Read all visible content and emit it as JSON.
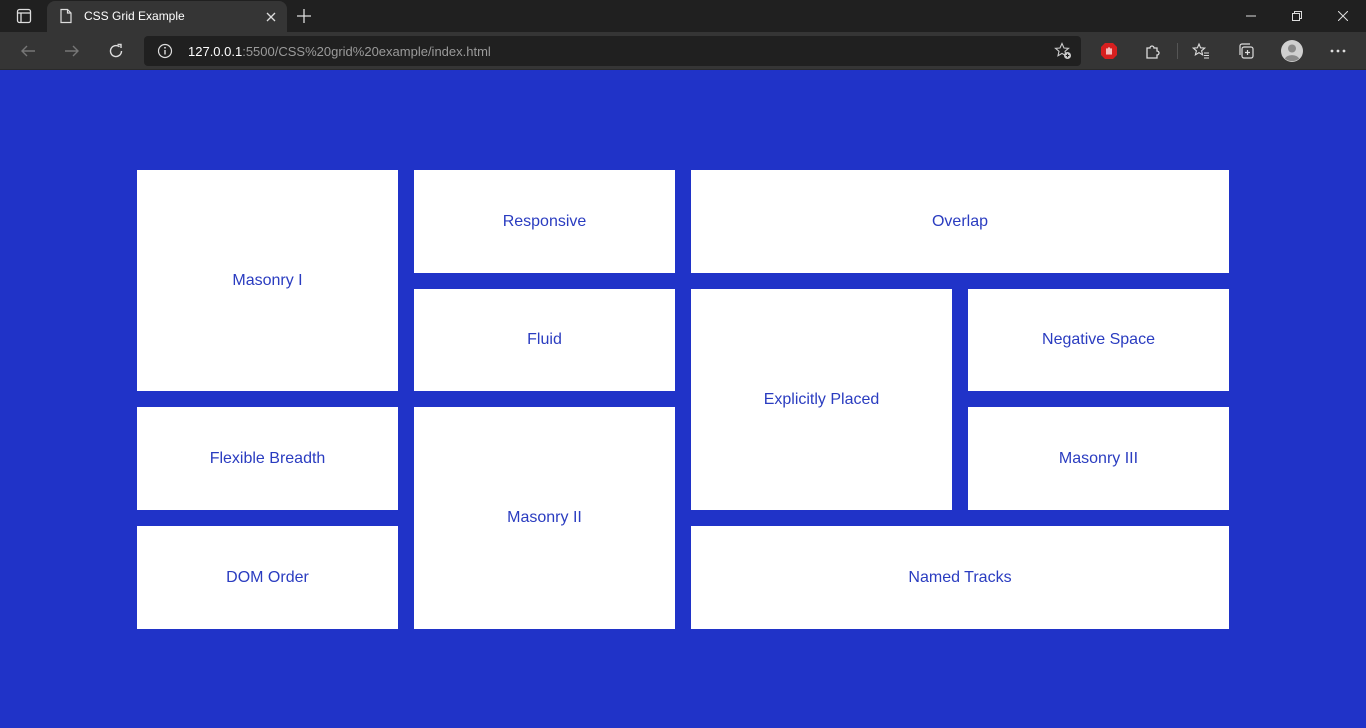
{
  "browser": {
    "tab_title": "CSS Grid Example",
    "url_host": "127.0.0.1",
    "url_rest": ":5500/CSS%20grid%20example/index.html"
  },
  "colors": {
    "page_background": "#2033c8",
    "cell_background": "#ffffff",
    "cell_text": "#2a3cc0"
  },
  "grid": {
    "items": [
      "Masonry I",
      "Responsive",
      "Overlap",
      "Fluid",
      "Negative Space",
      "Explicitly Placed",
      "Flexible Breadth",
      "Masonry III",
      "Masonry II",
      "DOM Order",
      "Named Tracks"
    ]
  }
}
